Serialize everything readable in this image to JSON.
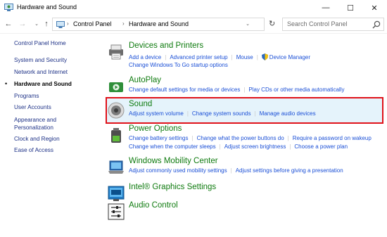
{
  "window": {
    "title": "Hardware and Sound",
    "minimize": "—",
    "maximize": "☐",
    "close": "✕"
  },
  "nav": {
    "back": "←",
    "forward": "→",
    "recent": "⌄",
    "up": "↑",
    "refresh": "↻",
    "breadcrumb": [
      "Control Panel",
      "Hardware and Sound"
    ],
    "breadcrumb_sep": "›",
    "search_placeholder": "Search Control Panel"
  },
  "sidebar": {
    "items": [
      {
        "label": "Control Panel Home"
      },
      {
        "label": "System and Security"
      },
      {
        "label": "Network and Internet"
      },
      {
        "label": "Hardware and Sound",
        "current": true
      },
      {
        "label": "Programs"
      },
      {
        "label": "User Accounts"
      },
      {
        "label": "Appearance and"
      },
      {
        "label": "Personalization"
      },
      {
        "label": "Clock and Region"
      },
      {
        "label": "Ease of Access"
      }
    ],
    "bullet": "•"
  },
  "categories": [
    {
      "title": "Devices and Printers",
      "icon": "printer-icon",
      "links_row1": [
        "Add a device",
        "Advanced printer setup",
        "Mouse",
        "Device Manager"
      ],
      "links_row2": [
        "Change Windows To Go startup options"
      ]
    },
    {
      "title": "AutoPlay",
      "icon": "autoplay-icon",
      "links_row1": [
        "Change default settings for media or devices",
        "Play CDs or other media automatically"
      ]
    },
    {
      "title": "Sound",
      "icon": "speaker-icon",
      "links_row1": [
        "Adjust system volume",
        "Change system sounds",
        "Manage audio devices"
      ]
    },
    {
      "title": "Power Options",
      "icon": "power-icon",
      "links_row1": [
        "Change battery settings",
        "Change what the power buttons do",
        "Require a password on wakeup"
      ],
      "links_row2": [
        "Change when the computer sleeps",
        "Adjust screen brightness",
        "Choose a power plan"
      ]
    },
    {
      "title": "Windows Mobility Center",
      "icon": "laptop-icon",
      "links_row1": [
        "Adjust commonly used mobility settings",
        "Adjust settings before giving a presentation"
      ]
    },
    {
      "title": "Intel® Graphics Settings",
      "icon": "intel-graphics-icon"
    },
    {
      "title": "Audio Control",
      "icon": "audio-control-icon"
    }
  ],
  "colors": {
    "category_title": "#0f7b0f",
    "link": "#1a4fd6",
    "sidebar_link": "#1e3287",
    "highlight_fill": "#e5f3fb",
    "highlight_border": "#e0121a"
  }
}
